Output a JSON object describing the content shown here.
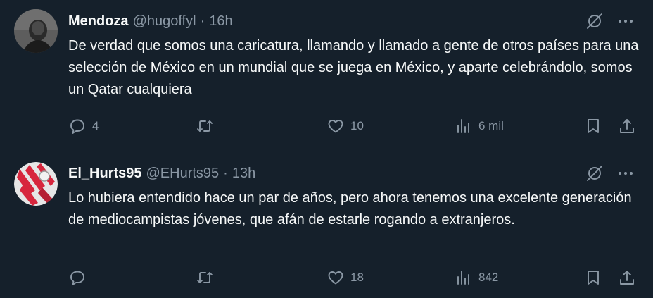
{
  "tweets": [
    {
      "name": "Mendoza",
      "handle": "@hugoffyl",
      "dot": "·",
      "time": "16h",
      "text": "De verdad que somos una caricatura, llamando y llamado a gente de otros países para una selección de México en un mundial que se juega en México, y aparte celebrándolo, somos un Qatar cualquiera",
      "replies": "4",
      "retweets": "",
      "likes": "10",
      "views": "6 mil"
    },
    {
      "name": "El_Hurts95",
      "handle": "@EHurts95",
      "dot": "·",
      "time": "13h",
      "text": "Lo hubiera entendido hace un par de años, pero ahora tenemos una excelente generación de mediocampistas jóvenes, que afán de estarle rogando a extranjeros.",
      "replies": "",
      "retweets": "",
      "likes": "18",
      "views": "842"
    }
  ],
  "icons": {
    "grok": "grok-icon",
    "more": "more-icon",
    "reply": "reply-icon",
    "retweet": "retweet-icon",
    "like": "like-icon",
    "views": "views-icon",
    "bookmark": "bookmark-icon",
    "share": "share-icon"
  },
  "colors": {
    "background": "#15202b",
    "text": "#f7f9f9",
    "muted": "#8b98a5",
    "divider": "#38444d"
  }
}
